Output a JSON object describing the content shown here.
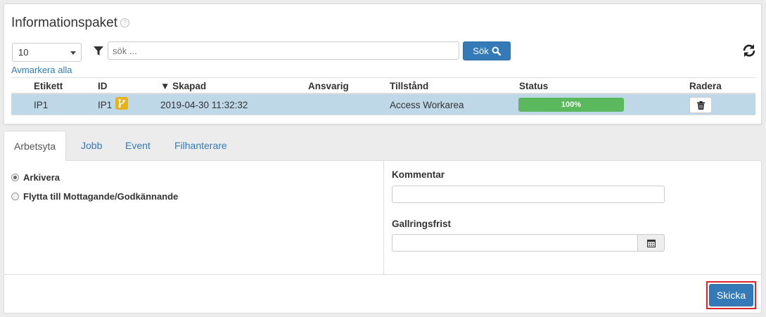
{
  "panel": {
    "title": "Informationspaket",
    "help_icon": "question-circle-icon",
    "page_size": "10",
    "search_placeholder": "sök ...",
    "search_button": "Sök",
    "unselect_all": "Avmarkera alla"
  },
  "table": {
    "headers": {
      "label": "Etikett",
      "id": "ID",
      "created": "▼ Skapad",
      "responsible": "Ansvarig",
      "state": "Tillstånd",
      "status": "Status",
      "delete": "Radera"
    },
    "rows": [
      {
        "label": "IP1",
        "id": "IP1",
        "created": "2019-04-30 11:32:32",
        "responsible": "",
        "state": "Access Workarea",
        "status_text": "100%",
        "progress": 1.0
      }
    ]
  },
  "tabs": [
    {
      "label": "Arbetsyta",
      "active": true
    },
    {
      "label": "Jobb"
    },
    {
      "label": "Event"
    },
    {
      "label": "Filhanterare"
    }
  ],
  "workarea": {
    "options": [
      {
        "label": "Arkivera",
        "checked": true
      },
      {
        "label": "Flytta till Mottagande/Godkännande",
        "checked": false
      }
    ],
    "comment_label": "Kommentar",
    "comment_value": "",
    "retention_label": "Gallringsfrist",
    "retention_value": "",
    "submit": "Skicka"
  },
  "colors": {
    "primary": "#337ab7",
    "selected_row": "#bfd8e8",
    "progress": "#5cb85c",
    "highlight": "#d9262a",
    "badge": "#e6b119"
  }
}
